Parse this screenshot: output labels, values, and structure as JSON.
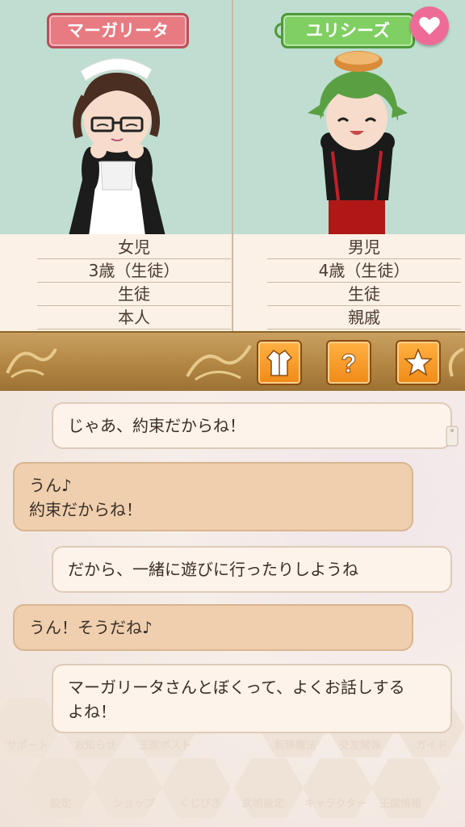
{
  "left_character": {
    "name": "マーガリータ",
    "info": [
      "女児",
      "3歳（生徒）",
      "生徒",
      "本人"
    ]
  },
  "right_character": {
    "name": "ユリシーズ",
    "info": [
      "男児",
      "4歳（生徒）",
      "生徒",
      "親戚"
    ]
  },
  "toolbar": {
    "buttons": [
      "outfit-icon",
      "help-icon",
      "star-icon"
    ]
  },
  "messages": [
    {
      "side": "right",
      "lines": [
        "じゃあ、約束だからね！"
      ]
    },
    {
      "side": "left",
      "lines": [
        "うん♪",
        "約束だからね！"
      ]
    },
    {
      "side": "right",
      "lines": [
        "だから、一緒に遊びに行ったりしようね"
      ]
    },
    {
      "side": "left",
      "lines": [
        "うん！そうだね♪"
      ]
    },
    {
      "side": "right",
      "lines": [
        "マーガリータさんとぼくって、よくお話しする",
        "よね！"
      ]
    }
  ],
  "background_menu": [
    "サポート",
    "お知らせ",
    "王家ポスト",
    "転移魔法",
    "交友関係",
    "ガイド",
    "設定",
    "ショップ",
    "くじびき",
    "武術設定",
    "キャラクター",
    "王国情報"
  ],
  "colors": {
    "portrait_bg": "#bfded1",
    "left_tag": "#e87b82",
    "right_tag": "#7fcf62",
    "heart": "#ef6b97",
    "toolbar_button": "#f08a18",
    "bubble_right": "#fdf3ea",
    "bubble_left": "#efcfae"
  }
}
